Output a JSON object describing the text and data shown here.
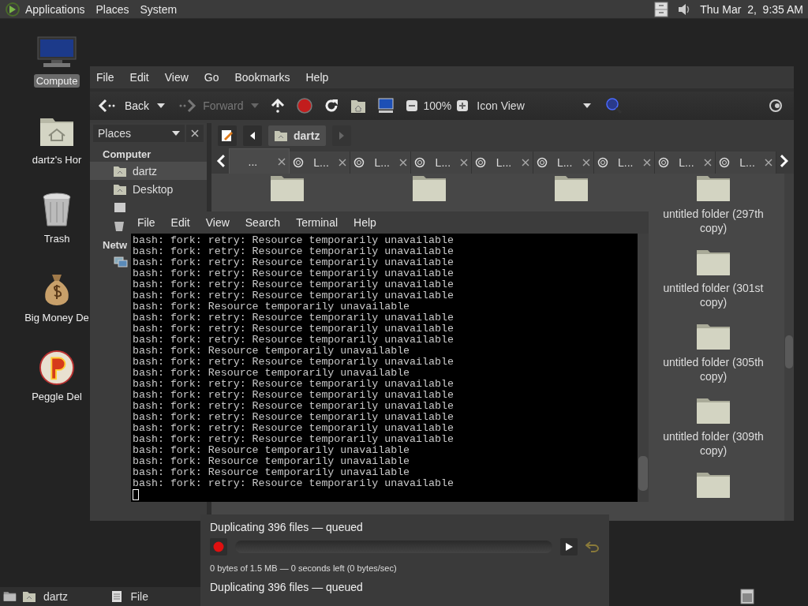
{
  "top_panel": {
    "menus": [
      "Applications",
      "Places",
      "System"
    ],
    "clock": "Thu Mar  2,  9:35 AM"
  },
  "desktop_icons": [
    {
      "label": "Compute",
      "kind": "computer",
      "selected": true
    },
    {
      "label": "dartz's Hor",
      "kind": "home",
      "selected": false
    },
    {
      "label": "Trash",
      "kind": "trash",
      "selected": false
    },
    {
      "label": "Big Money De",
      "kind": "moneybag",
      "selected": false
    },
    {
      "label": "Peggle Del",
      "kind": "ball",
      "selected": false
    }
  ],
  "file_manager": {
    "menu": [
      "File",
      "Edit",
      "View",
      "Go",
      "Bookmarks",
      "Help"
    ],
    "toolbar": {
      "back": {
        "label": "Back",
        "disabled": false
      },
      "forward": {
        "label": "Forward",
        "disabled": true
      },
      "zoom": "100%",
      "view_mode": "Icon View"
    },
    "side_pane": {
      "title": "Places",
      "sections": [
        {
          "heading": "Computer",
          "items": [
            {
              "label": "dartz",
              "selected": true
            },
            {
              "label": "Desktop",
              "selected": false
            }
          ]
        },
        {
          "heading": "Netw"
        }
      ]
    },
    "path": [
      {
        "label": "dartz",
        "selected": true
      }
    ],
    "tabs": [
      {
        "label": "...",
        "selected": true
      },
      {
        "label": "L...",
        "selected": false
      },
      {
        "label": "L...",
        "selected": false
      },
      {
        "label": "L...",
        "selected": false
      },
      {
        "label": "L...",
        "selected": false
      },
      {
        "label": "L...",
        "selected": false
      },
      {
        "label": "L...",
        "selected": false
      },
      {
        "label": "L...",
        "selected": false
      },
      {
        "label": "L...",
        "selected": false
      }
    ],
    "folders": [
      {
        "label": "untitled folder (297th copy)"
      },
      {
        "label": "untitled folder (301st copy)"
      },
      {
        "label": "untitled folder (305th copy)"
      },
      {
        "label": "untitled folder (309th copy)"
      }
    ]
  },
  "terminal": {
    "menu": [
      "File",
      "Edit",
      "View",
      "Search",
      "Terminal",
      "Help"
    ],
    "lines": [
      "bash: fork: retry: Resource temporarily unavailable",
      "bash: fork: retry: Resource temporarily unavailable",
      "bash: fork: retry: Resource temporarily unavailable",
      "bash: fork: retry: Resource temporarily unavailable",
      "bash: fork: retry: Resource temporarily unavailable",
      "bash: fork: retry: Resource temporarily unavailable",
      "bash: fork: Resource temporarily unavailable",
      "bash: fork: retry: Resource temporarily unavailable",
      "bash: fork: retry: Resource temporarily unavailable",
      "bash: fork: retry: Resource temporarily unavailable",
      "bash: fork: Resource temporarily unavailable",
      "bash: fork: retry: Resource temporarily unavailable",
      "bash: fork: Resource temporarily unavailable",
      "bash: fork: retry: Resource temporarily unavailable",
      "bash: fork: retry: Resource temporarily unavailable",
      "bash: fork: retry: Resource temporarily unavailable",
      "bash: fork: retry: Resource temporarily unavailable",
      "bash: fork: retry: Resource temporarily unavailable",
      "bash: fork: retry: Resource temporarily unavailable",
      "bash: fork: Resource temporarily unavailable",
      "bash: fork: Resource temporarily unavailable",
      "bash: fork: Resource temporarily unavailable",
      "bash: fork: retry: Resource temporarily unavailable"
    ]
  },
  "file_operations": [
    {
      "title": "Duplicating 396 files — queued",
      "level": 0,
      "details": "0 bytes of 1.5 MB — 0 seconds left (0 bytes/sec)"
    },
    {
      "title": "Duplicating 396 files — queued"
    }
  ],
  "taskbar": {
    "tasks": [
      {
        "label": "dartz",
        "kind": "folder"
      },
      {
        "label": "File",
        "kind": "document"
      }
    ]
  }
}
